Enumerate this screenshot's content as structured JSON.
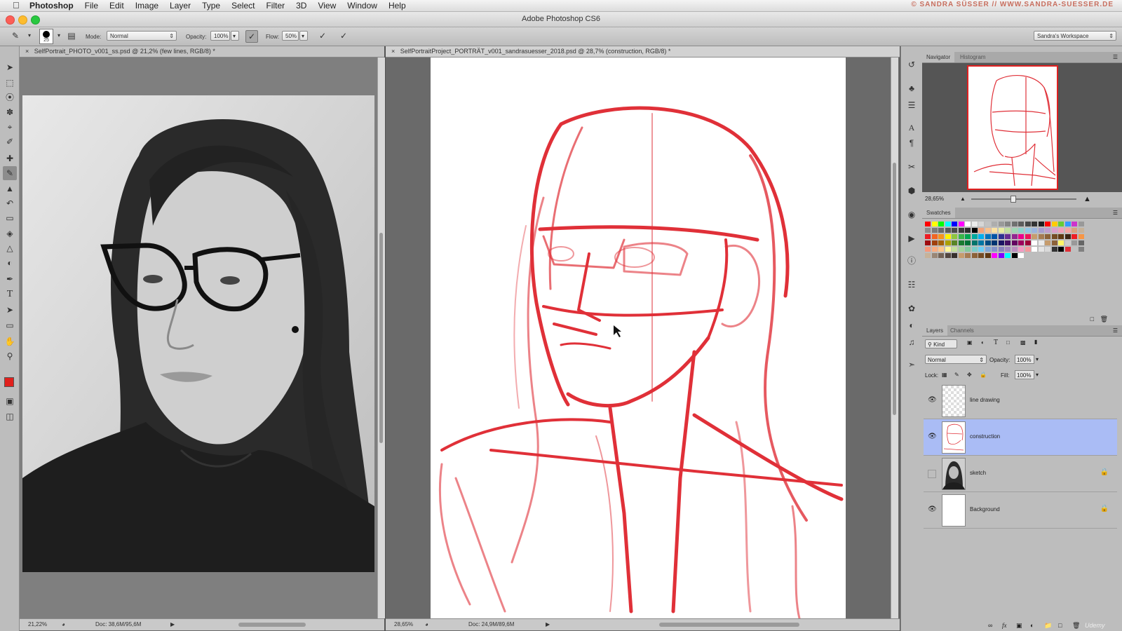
{
  "menubar": {
    "app_name": "Photoshop",
    "items": [
      "File",
      "Edit",
      "Image",
      "Layer",
      "Type",
      "Select",
      "Filter",
      "3D",
      "View",
      "Window",
      "Help"
    ],
    "credit": "© SANDRA SÜSSER // WWW.SANDRA-SUESSER.DE"
  },
  "window": {
    "title": "Adobe Photoshop CS6"
  },
  "options_bar": {
    "mode_label": "Mode:",
    "mode_value": "Normal",
    "opacity_label": "Opacity:",
    "opacity_value": "100%",
    "flow_label": "Flow:",
    "flow_value": "50%",
    "brush_size": "25",
    "workspace": "Sandra's Workspace"
  },
  "doc1": {
    "tab_title": "SelfPortrait_PHOTO_v001_ss.psd @ 21,2% (few lines, RGB/8) *",
    "zoom": "21,22%",
    "doc_info": "Doc: 38,6M/95,6M"
  },
  "doc2": {
    "tab_title": "SelfPortraitProject_PORTRÄT_v001_sandrasuesser_2018.psd @ 28,7% (construction, RGB/8) *",
    "zoom": "28,65%",
    "doc_info": "Doc: 24,9M/89,6M"
  },
  "navigator": {
    "tab_active": "Navigator",
    "tab_inactive": "Histogram",
    "zoom": "28,65%"
  },
  "swatches": {
    "title": "Swatches"
  },
  "layers_panel": {
    "tab_active": "Layers",
    "tab_inactive": "Channels",
    "kind_filter": "Kind",
    "blend_mode": "Normal",
    "opacity_label": "Opacity:",
    "opacity_value": "100%",
    "lock_label": "Lock:",
    "fill_label": "Fill:",
    "fill_value": "100%",
    "layers": [
      {
        "name": "line drawing",
        "visible": true,
        "selected": false,
        "locked": false
      },
      {
        "name": "construction",
        "visible": true,
        "selected": true,
        "locked": false
      },
      {
        "name": "sketch",
        "visible": false,
        "selected": false,
        "locked": true
      },
      {
        "name": "Background",
        "visible": true,
        "selected": false,
        "locked": true
      }
    ]
  },
  "colors": {
    "foreground": "#e0201c",
    "background": "#ffffff",
    "sketch_line": "#e03038",
    "layer_selected": "#aabcf5"
  },
  "watermark": "Udemy"
}
